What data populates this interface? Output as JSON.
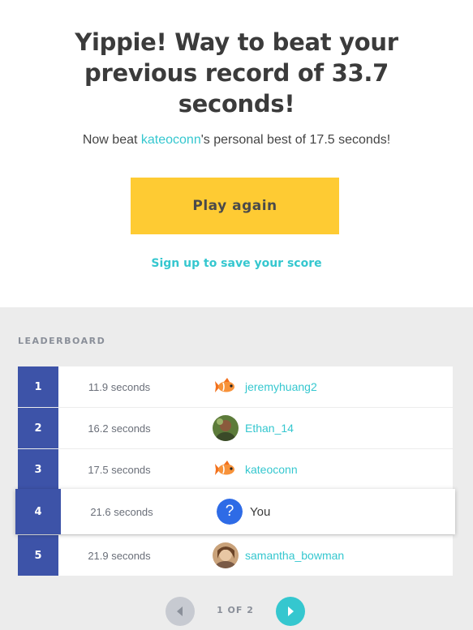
{
  "result": {
    "headline": "Yippie! Way to beat your previous record of 33.7 seconds!",
    "challenge_prefix": "Now beat ",
    "challenge_user": "kateoconn",
    "challenge_suffix": "'s personal best of 17.5 seconds!",
    "play_again_label": "Play again",
    "signup_label": "Sign up to save your score"
  },
  "leaderboard": {
    "title": "LEADERBOARD",
    "rows": [
      {
        "rank": "1",
        "time": "11.9 seconds",
        "name": "jeremyhuang2",
        "avatar": "goldfish-icon"
      },
      {
        "rank": "2",
        "time": "16.2 seconds",
        "name": "Ethan_14",
        "avatar": "photo-avatar"
      },
      {
        "rank": "3",
        "time": "17.5 seconds",
        "name": "kateoconn",
        "avatar": "goldfish-icon"
      },
      {
        "rank": "4",
        "time": "21.6 seconds",
        "name": "You",
        "avatar": "question-icon",
        "highlight": true
      },
      {
        "rank": "5",
        "time": "21.9 seconds",
        "name": "samantha_bowman",
        "avatar": "photo-avatar"
      }
    ],
    "pagination": {
      "label": "1 OF 2",
      "current": 1,
      "total": 2
    }
  },
  "colors": {
    "accent": "#35c7cf",
    "button": "#fecb33",
    "rank_bg": "#3d53a8",
    "panel_bg": "#ececec",
    "you_icon": "#2e6be6"
  }
}
